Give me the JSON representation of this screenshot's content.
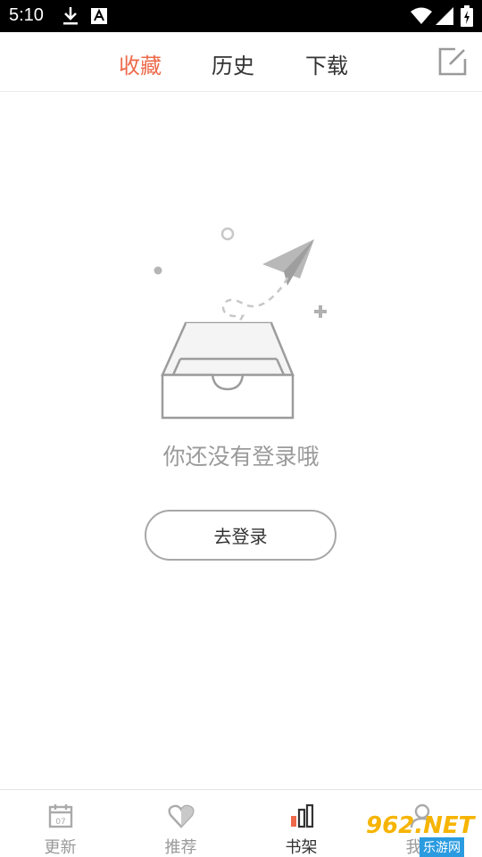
{
  "status_bar": {
    "time": "5:10",
    "icons": [
      "download-icon",
      "text-a-icon",
      "wifi-icon",
      "signal-icon",
      "battery-icon"
    ]
  },
  "top_tabs": {
    "items": [
      {
        "label": "收藏",
        "active": true
      },
      {
        "label": "历史",
        "active": false
      },
      {
        "label": "下载",
        "active": false
      }
    ],
    "edit_icon": "edit-icon"
  },
  "empty_state": {
    "message": "你还没有登录哦",
    "button_label": "去登录"
  },
  "bottom_nav": {
    "items": [
      {
        "label": "更新",
        "icon": "calendar-icon",
        "badge_text": "07",
        "active": false
      },
      {
        "label": "推荐",
        "icon": "heart-icon",
        "active": false
      },
      {
        "label": "书架",
        "icon": "bar-chart-icon",
        "active": true
      },
      {
        "label": "我的",
        "icon": "user-icon",
        "active": false
      }
    ]
  },
  "watermark": {
    "brand": "962.NET",
    "sub": "乐游网"
  },
  "colors": {
    "accent": "#ee6a4b",
    "text": "#333333",
    "muted": "#9a9a9a"
  }
}
